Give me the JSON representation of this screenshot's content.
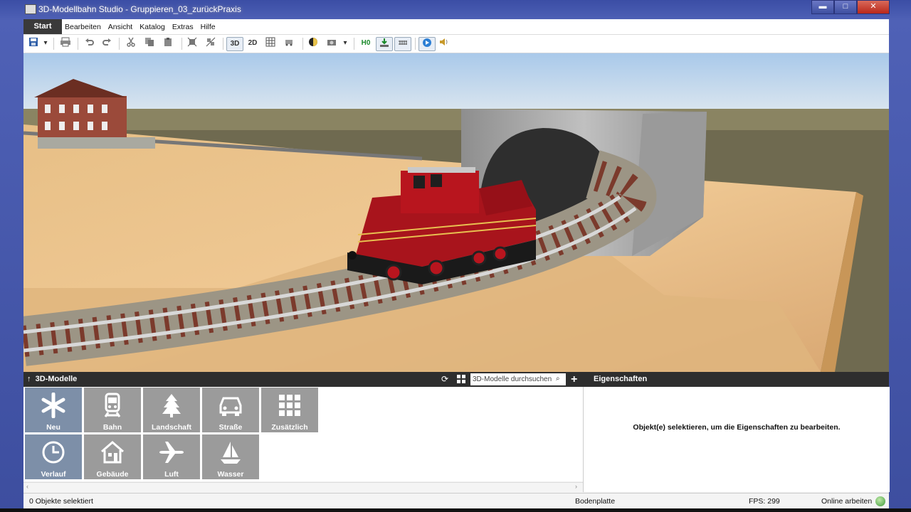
{
  "window": {
    "title": "3D-Modellbahn Studio - Gruppieren_03_zurückPraxis",
    "controls": {
      "minimize": "▬",
      "maximize": "□",
      "close": "✕"
    }
  },
  "menu": {
    "start": "Start",
    "items": [
      "Bearbeiten",
      "Ansicht",
      "Katalog",
      "Extras",
      "Hilfe"
    ]
  },
  "toolbar": {
    "view_3d": "3D",
    "view_2d": "2D",
    "scale": "H0"
  },
  "panel": {
    "title": "3D-Modelle",
    "search_placeholder": "3D-Modelle durchsuchen",
    "properties_title": "Eigenschaften",
    "properties_message": "Objekt(e) selektieren, um die Eigenschaften zu bearbeiten."
  },
  "categories": [
    {
      "label": "Neu",
      "icon": "asterisk-icon"
    },
    {
      "label": "Bahn",
      "icon": "train-icon"
    },
    {
      "label": "Landschaft",
      "icon": "tree-icon"
    },
    {
      "label": "Straße",
      "icon": "car-icon"
    },
    {
      "label": "Zusätzlich",
      "icon": "grid-icon"
    },
    {
      "label": "Verlauf",
      "icon": "clock-icon"
    },
    {
      "label": "Gebäude",
      "icon": "house-icon"
    },
    {
      "label": "Luft",
      "icon": "airplane-icon"
    },
    {
      "label": "Wasser",
      "icon": "sailboat-icon"
    }
  ],
  "status": {
    "selection": "0 Objekte selektiert",
    "layer": "Bodenplatte",
    "fps": "FPS: 299",
    "online": "Online arbeiten"
  },
  "colors": {
    "accent": "#3d4e9f",
    "tile": "#9b9b9b",
    "tile_active": "#7d8fa8",
    "locomotive": "#a8141c"
  }
}
